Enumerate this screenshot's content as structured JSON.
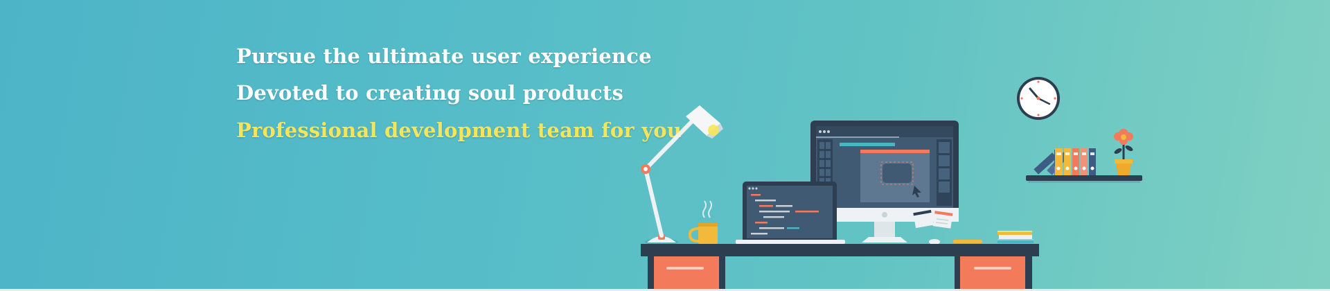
{
  "hero": {
    "headline_1": "Pursue the ultimate user experience",
    "headline_2": "Devoted to creating soul products",
    "headline_3": "Professional development team for you"
  },
  "colors": {
    "background_start": "#4db4c8",
    "background_end": "#7fd0c2",
    "headline": "#ffffff",
    "highlight": "#f4e55a",
    "desk": "#2c3e50",
    "drawer": "#f47a5c"
  },
  "illustration": {
    "icons": [
      "desk-lamp-icon",
      "coffee-mug-icon",
      "laptop-icon",
      "monitor-icon",
      "sticky-notes-icon",
      "books-icon",
      "wall-clock-icon",
      "binders-icon",
      "flower-pot-icon",
      "desk-icon"
    ]
  }
}
